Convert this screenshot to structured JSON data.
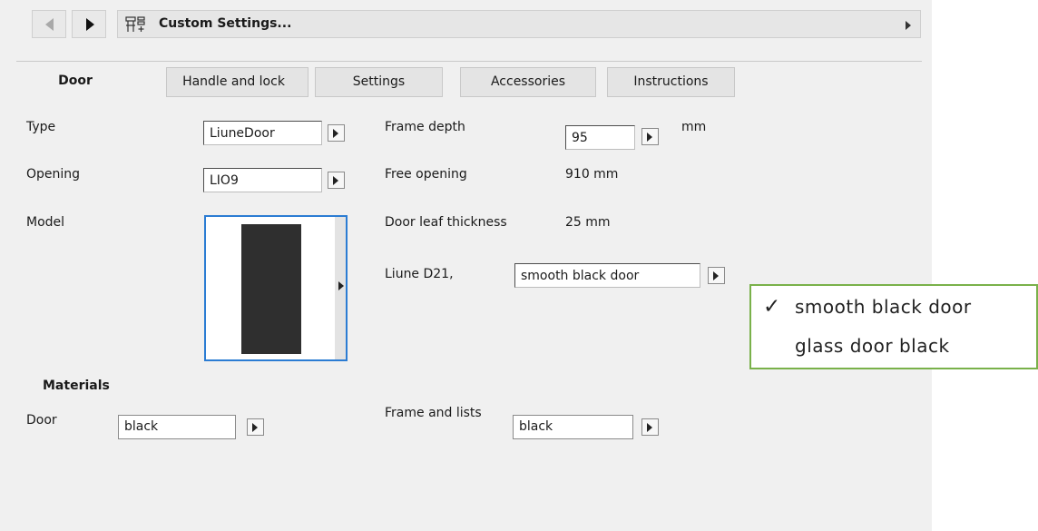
{
  "toolbar": {
    "title": "Custom Settings..."
  },
  "tabs": [
    {
      "label": "Door",
      "active": true
    },
    {
      "label": "Handle and lock",
      "active": false
    },
    {
      "label": "Settings",
      "active": false
    },
    {
      "label": "Accessories",
      "active": false
    },
    {
      "label": "Instructions",
      "active": false
    }
  ],
  "fields": {
    "type": {
      "label": "Type",
      "value": "LiuneDoor"
    },
    "opening": {
      "label": "Opening",
      "value": "LIO9"
    },
    "model": {
      "label": "Model"
    },
    "frame_depth": {
      "label": "Frame depth",
      "value": "95",
      "unit": "mm"
    },
    "free_opening": {
      "label": "Free opening",
      "value": "910 mm"
    },
    "door_leaf_thickness": {
      "label": "Door leaf thickness",
      "value": "25 mm"
    },
    "liune": {
      "label": "Liune D21,",
      "value": "smooth black door"
    }
  },
  "materials": {
    "heading": "Materials",
    "door": {
      "label": "Door",
      "value": "black"
    },
    "frame_lists": {
      "label": "Frame and lists",
      "value": "black"
    }
  },
  "popup": {
    "selected": "smooth black door",
    "options": [
      "smooth black door",
      "glass door black"
    ],
    "check_glyph": "✓",
    "border_color": "#79b14a"
  },
  "colors": {
    "panel_bg": "#f0f0f0",
    "model_border": "#2b7cd3",
    "door_fill": "#2f2f2f"
  }
}
